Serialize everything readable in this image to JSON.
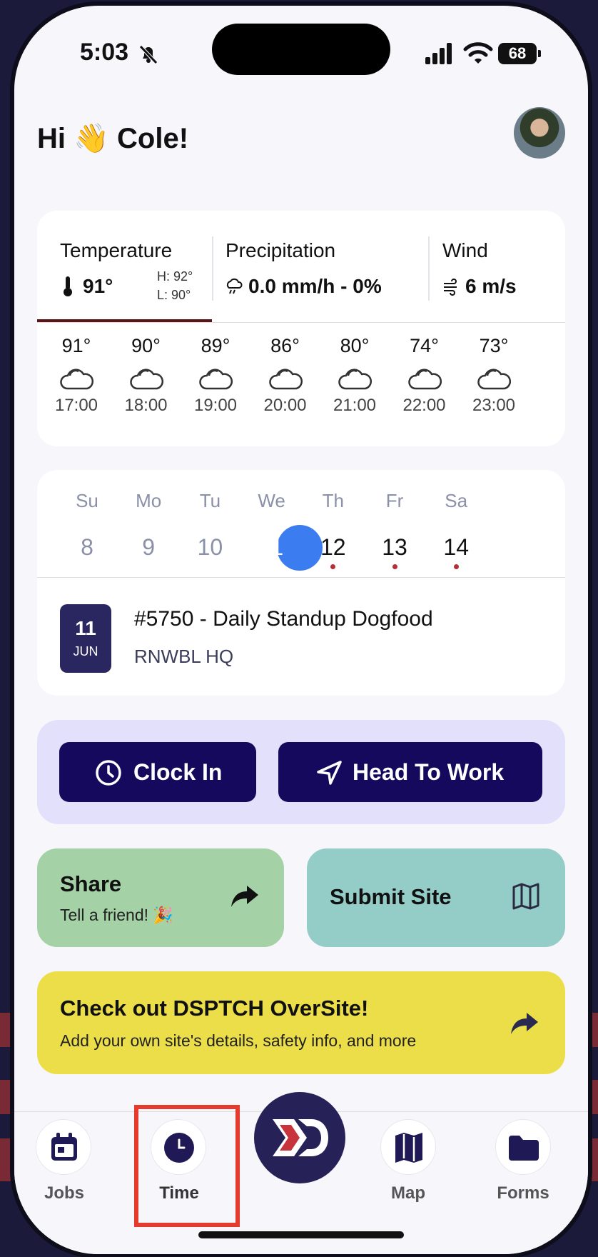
{
  "status_bar": {
    "time": "5:03",
    "battery": "68"
  },
  "greeting": {
    "text": "Hi 👋 Cole!"
  },
  "weather": {
    "temperature": {
      "label": "Temperature",
      "value": "91°",
      "high": "H: 92°",
      "low": "L: 90°"
    },
    "precipitation": {
      "label": "Precipitation",
      "value": "0.0 mm/h - 0%"
    },
    "wind": {
      "label": "Wind",
      "value": "6 m/s"
    },
    "hourly": [
      {
        "temp": "91°",
        "time": "17:00"
      },
      {
        "temp": "90°",
        "time": "18:00"
      },
      {
        "temp": "89°",
        "time": "19:00"
      },
      {
        "temp": "86°",
        "time": "20:00"
      },
      {
        "temp": "80°",
        "time": "21:00"
      },
      {
        "temp": "74°",
        "time": "22:00"
      },
      {
        "temp": "73°",
        "time": "23:00"
      }
    ]
  },
  "calendar": {
    "days": [
      {
        "dow": "Su",
        "num": "8"
      },
      {
        "dow": "Mo",
        "num": "9"
      },
      {
        "dow": "Tu",
        "num": "10"
      },
      {
        "dow": "We",
        "num": "11"
      },
      {
        "dow": "Th",
        "num": "12"
      },
      {
        "dow": "Fr",
        "num": "13"
      },
      {
        "dow": "Sa",
        "num": "14"
      }
    ],
    "job": {
      "day": "11",
      "month": "JUN",
      "title": "#5750 - Daily Standup Dogfood",
      "location": "RNWBL HQ"
    }
  },
  "actions": {
    "clock_in": "Clock In",
    "head_to_work": "Head To Work"
  },
  "tiles": {
    "share": {
      "title": "Share",
      "subtitle": "Tell a friend! 🎉"
    },
    "submit_site": {
      "title": "Submit Site"
    }
  },
  "promo": {
    "title": "Check out DSPTCH OverSite!",
    "subtitle": "Add your own site's details, safety info, and more"
  },
  "nav": {
    "jobs": "Jobs",
    "time": "Time",
    "map": "Map",
    "forms": "Forms"
  },
  "colors": {
    "accent": "#14095c",
    "selected_day": "#3b7cf0",
    "highlight": "#e53b2f"
  }
}
